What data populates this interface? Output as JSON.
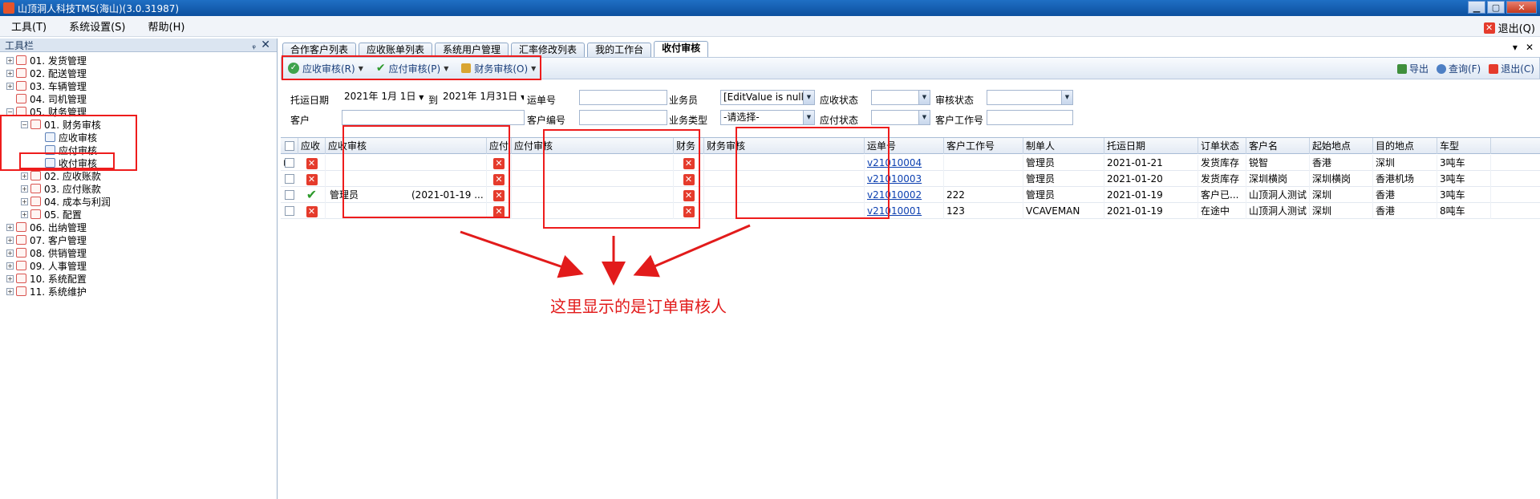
{
  "window": {
    "title": "山顶洞人科技TMS(海山)(3.0.31987)",
    "exit_label": "退出(Q)"
  },
  "menu": [
    "工具(T)",
    "系统设置(S)",
    "帮助(H)"
  ],
  "left_panel": {
    "title": "工具栏",
    "pin": "ᵩ",
    "close": "✕",
    "tree": [
      {
        "level": 0,
        "exp": "+",
        "label": "01. 发货管理"
      },
      {
        "level": 0,
        "exp": "+",
        "label": "02. 配送管理"
      },
      {
        "level": 0,
        "exp": "+",
        "label": "03. 车辆管理"
      },
      {
        "level": 0,
        "exp": "",
        "label": "04. 司机管理"
      },
      {
        "level": 0,
        "exp": "−",
        "label": "05. 财务管理"
      },
      {
        "level": 1,
        "exp": "−",
        "label": "01. 财务审核"
      },
      {
        "level": 2,
        "exp": "",
        "label": "应收审核"
      },
      {
        "level": 2,
        "exp": "",
        "label": "应付审核"
      },
      {
        "level": 2,
        "exp": "",
        "label": "收付审核"
      },
      {
        "level": 1,
        "exp": "+",
        "label": "02. 应收账款"
      },
      {
        "level": 1,
        "exp": "+",
        "label": "03. 应付账款"
      },
      {
        "level": 1,
        "exp": "+",
        "label": "04. 成本与利润"
      },
      {
        "level": 1,
        "exp": "+",
        "label": "05. 配置"
      },
      {
        "level": 0,
        "exp": "+",
        "label": "06. 出纳管理"
      },
      {
        "level": 0,
        "exp": "+",
        "label": "07. 客户管理"
      },
      {
        "level": 0,
        "exp": "+",
        "label": "08. 供销管理"
      },
      {
        "level": 0,
        "exp": "+",
        "label": "09. 人事管理"
      },
      {
        "level": 0,
        "exp": "+",
        "label": "10. 系统配置"
      },
      {
        "level": 0,
        "exp": "+",
        "label": "11. 系统维护"
      }
    ]
  },
  "tabs": [
    {
      "label": "合作客户列表"
    },
    {
      "label": "应收账单列表"
    },
    {
      "label": "系统用户管理"
    },
    {
      "label": "汇率修改列表"
    },
    {
      "label": "我的工作台"
    },
    {
      "label": "收付审核",
      "active": true
    }
  ],
  "tabs_right": [
    "▾",
    "✕"
  ],
  "toolbar": {
    "buttons": [
      {
        "label": "应收审核(R)"
      },
      {
        "label": "应付审核(P)"
      },
      {
        "label": "财务审核(O)"
      }
    ],
    "right": [
      "导出",
      "查询(F)",
      "退出(C)"
    ]
  },
  "filter": {
    "ship_date_label": "托运日期",
    "date_from": "2021年 1月 1日",
    "to_label": "到",
    "date_to": "2021年 1月31日",
    "waybill_label": "运单号",
    "salesman_label": "业务员",
    "salesman_value": "[EditValue is null]",
    "ar_status_label": "应收状态",
    "audit_status_label": "审核状态",
    "customer_label": "客户",
    "customer_code_label": "客户编号",
    "biz_type_label": "业务类型",
    "biz_type_value": "-请选择-",
    "ap_status_label": "应付状态",
    "customer_job_label": "客户工作号"
  },
  "grid": {
    "headers": [
      "应收",
      "应收审核",
      "应付",
      "应付审核",
      "财务",
      "财务审核",
      "运单号",
      "客户工作号",
      "制单人",
      "托运日期",
      "订单状态",
      "客户名",
      "起始地点",
      "目的地点",
      "车型"
    ],
    "rows": [
      {
        "ar": "x",
        "ar_audit": "",
        "ar_time": "",
        "ap": "x",
        "fin": "x",
        "waybill": "v21010004",
        "job": "",
        "creator": "管理员",
        "date": "2021-01-21",
        "status": "发货库存",
        "customer": "锐智",
        "from": "香港",
        "to": "深圳",
        "truck": "3吨车"
      },
      {
        "ar": "x",
        "ar_audit": "",
        "ar_time": "",
        "ap": "x",
        "fin": "x",
        "waybill": "v21010003",
        "job": "",
        "creator": "管理员",
        "date": "2021-01-20",
        "status": "发货库存",
        "customer": "深圳横岗",
        "from": "深圳横岗",
        "to": "香港机场",
        "truck": "3吨车"
      },
      {
        "ar": "ok",
        "ar_audit": "管理员",
        "ar_time": "(2021-01-19 ...",
        "ap": "x",
        "fin": "x",
        "waybill": "v21010002",
        "job": "222",
        "creator": "管理员",
        "date": "2021-01-19",
        "status": "客户已...",
        "customer": "山顶洞人测试",
        "from": "深圳",
        "to": "香港",
        "truck": "3吨车"
      },
      {
        "ar": "x",
        "ar_audit": "",
        "ar_time": "",
        "ap": "x",
        "fin": "x",
        "waybill": "v21010001",
        "job": "123",
        "creator": "VCAVEMAN",
        "date": "2021-01-19",
        "status": "在途中",
        "customer": "山顶洞人测试",
        "from": "深圳",
        "to": "香港",
        "truck": "8吨车"
      }
    ]
  },
  "annotation": "这里显示的是订单审核人",
  "colors": {
    "highlight": "#ee1c1c",
    "link": "#0b3fb0"
  }
}
